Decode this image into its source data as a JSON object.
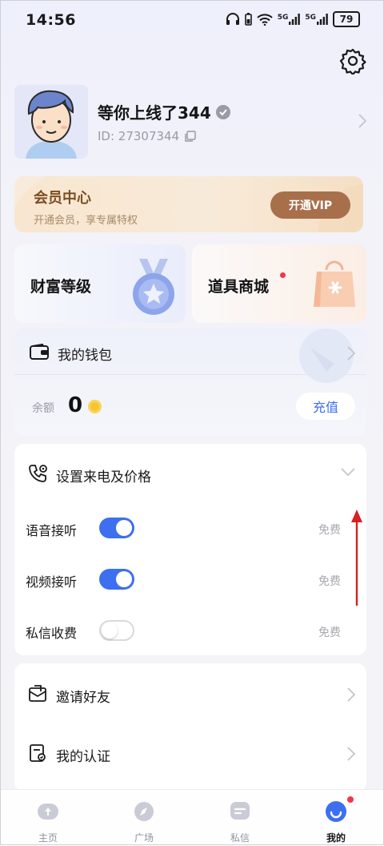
{
  "status_bar": {
    "time": "14:56",
    "battery": "79",
    "network_1": "5G",
    "network_2": "5G"
  },
  "profile": {
    "nickname": "等你上线了344",
    "id_text": "ID: 27307344"
  },
  "vip": {
    "title": "会员中心",
    "subtitle": "开通会员，享专属特权",
    "button": "开通VIP"
  },
  "tiles": {
    "wealth": "财富等级",
    "shop": "道具商城"
  },
  "wallet": {
    "title": "我的钱包",
    "balance_label": "余额",
    "balance": "0",
    "recharge": "充值"
  },
  "settings": {
    "title": "设置来电及价格",
    "rows": [
      {
        "label": "语音接听",
        "enabled": true,
        "price": "免费"
      },
      {
        "label": "视频接听",
        "enabled": true,
        "price": "免费"
      },
      {
        "label": "私信收费",
        "enabled": false,
        "price": "免费"
      }
    ]
  },
  "links": [
    {
      "label": "邀请好友"
    },
    {
      "label": "我的认证"
    }
  ],
  "nav": [
    {
      "label": "主页"
    },
    {
      "label": "广场"
    },
    {
      "label": "私信"
    },
    {
      "label": "我的"
    }
  ],
  "colors": {
    "accent": "#3d6ff0",
    "vip_button": "#a86f4b",
    "badge": "#f0364a",
    "annotation_arrow": "#d42222"
  }
}
